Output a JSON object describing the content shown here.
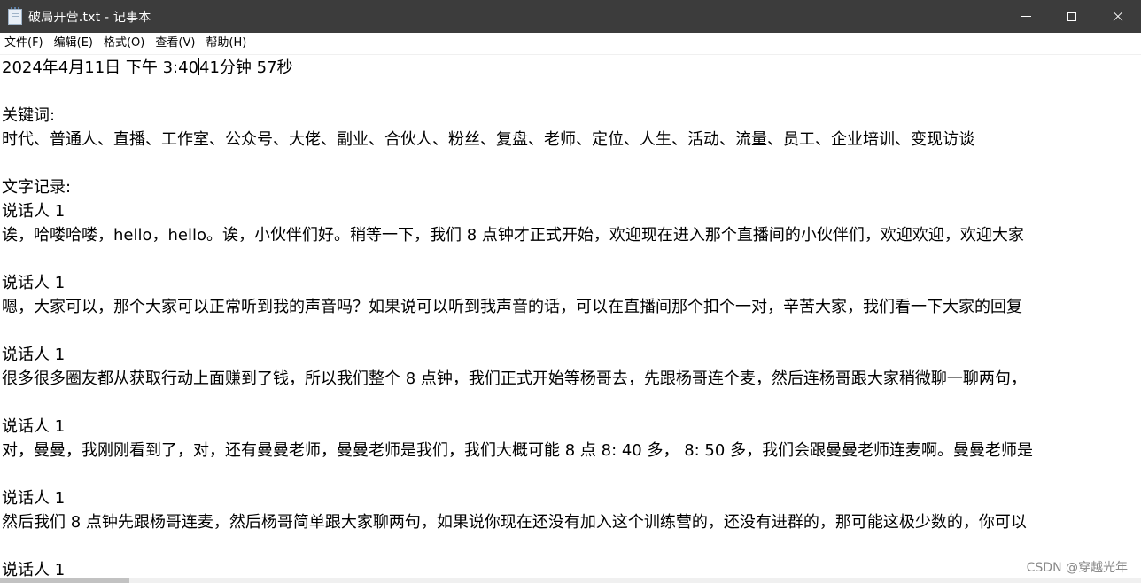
{
  "window": {
    "title": "破局开营.txt - 记事本",
    "icon": "notepad-icon"
  },
  "controls": {
    "minimize": "minimize-icon",
    "maximize": "maximize-icon",
    "close": "close-icon"
  },
  "menu": {
    "file": "文件(F)",
    "edit": "编辑(E)",
    "format": "格式(O)",
    "view": "查看(V)",
    "help": "帮助(H)"
  },
  "document": {
    "timestamp_before_caret": "2024年4月11日 下午 3:40",
    "timestamp_after_caret": "41分钟 57秒",
    "keywords_label": "关键词:",
    "keywords": "时代、普通人、直播、工作室、公众号、大佬、副业、合伙人、粉丝、复盘、老师、定位、人生、活动、流量、员工、企业培训、变现访谈",
    "transcript_label": "文字记录:",
    "entries": [
      {
        "speaker": "说话人 1",
        "text": "诶，哈喽哈喽，hello，hello。诶，小伙伴们好。稍等一下，我们 8 点钟才正式开始，欢迎现在进入那个直播间的小伙伴们，欢迎欢迎，欢迎大家"
      },
      {
        "speaker": "说话人 1",
        "text": "嗯，大家可以，那个大家可以正常听到我的声音吗？如果说可以听到我声音的话，可以在直播间那个扣个一对，辛苦大家，我们看一下大家的回复"
      },
      {
        "speaker": "说话人 1",
        "text": "很多很多圈友都从获取行动上面赚到了钱，所以我们整个 8 点钟，我们正式开始等杨哥去，先跟杨哥连个麦，然后连杨哥跟大家稍微聊一聊两句，"
      },
      {
        "speaker": "说话人 1",
        "text": "对，曼曼，我刚刚看到了，对，还有曼曼老师，曼曼老师是我们，我们大概可能 8 点 8: 40 多， 8: 50 多，我们会跟曼曼老师连麦啊。曼曼老师是"
      },
      {
        "speaker": "说话人 1",
        "text": "然后我们 8 点钟先跟杨哥连麦，然后杨哥简单跟大家聊两句，如果说你现在还没有加入这个训练营的，还没有进群的，那可能这极少数的，你可以"
      },
      {
        "speaker": "说话人 1",
        "text": ""
      }
    ]
  },
  "watermark": "CSDN @穿越光年"
}
